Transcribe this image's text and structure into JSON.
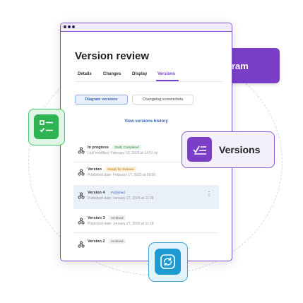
{
  "background_pill": {
    "label": "ram"
  },
  "window": {
    "title": "Version review",
    "tabs": [
      {
        "label": "Details"
      },
      {
        "label": "Changes"
      },
      {
        "label": "Display"
      },
      {
        "label": "Versions",
        "active": true
      }
    ],
    "segmented": [
      {
        "label": "Diagram versions",
        "active": true
      },
      {
        "label": "Changelog screenshots",
        "active": false
      }
    ],
    "history_link": "View versions history",
    "rows": [
      {
        "title": "In progress",
        "badge": "Draft: Completed",
        "subtitle": "Last modified: February 19, 2025 at 14:51 by",
        "icon": "branch-icon"
      },
      {
        "title": "Version",
        "badge": "Ready for Release",
        "subtitle": "Published date: February 17, 2025 at 09:50",
        "icon": "branch-icon"
      },
      {
        "title": "Version 4",
        "badge": "Published",
        "subtitle": "Published date: January 27, 2025 at 11:28",
        "icon": "branch-icon",
        "selected": true
      },
      {
        "title": "Version 3",
        "badge": "Archived",
        "subtitle": "Published date: January 27, 2025 at 11:28",
        "icon": "branch-icon"
      },
      {
        "title": "Version 2",
        "badge": "Archived",
        "subtitle": "",
        "icon": "branch-icon"
      }
    ]
  },
  "floating_cards": {
    "checklist": {
      "icon": "checklist-icon",
      "color": "#2fb352"
    },
    "versions": {
      "label": "Versions",
      "icon": "versions-icon",
      "color": "#7a3fc6"
    },
    "sync": {
      "icon": "sync-icon",
      "color": "#1f9bd3"
    }
  },
  "colors": {
    "accent": "#7a3fc6",
    "link": "#3a63b5"
  }
}
